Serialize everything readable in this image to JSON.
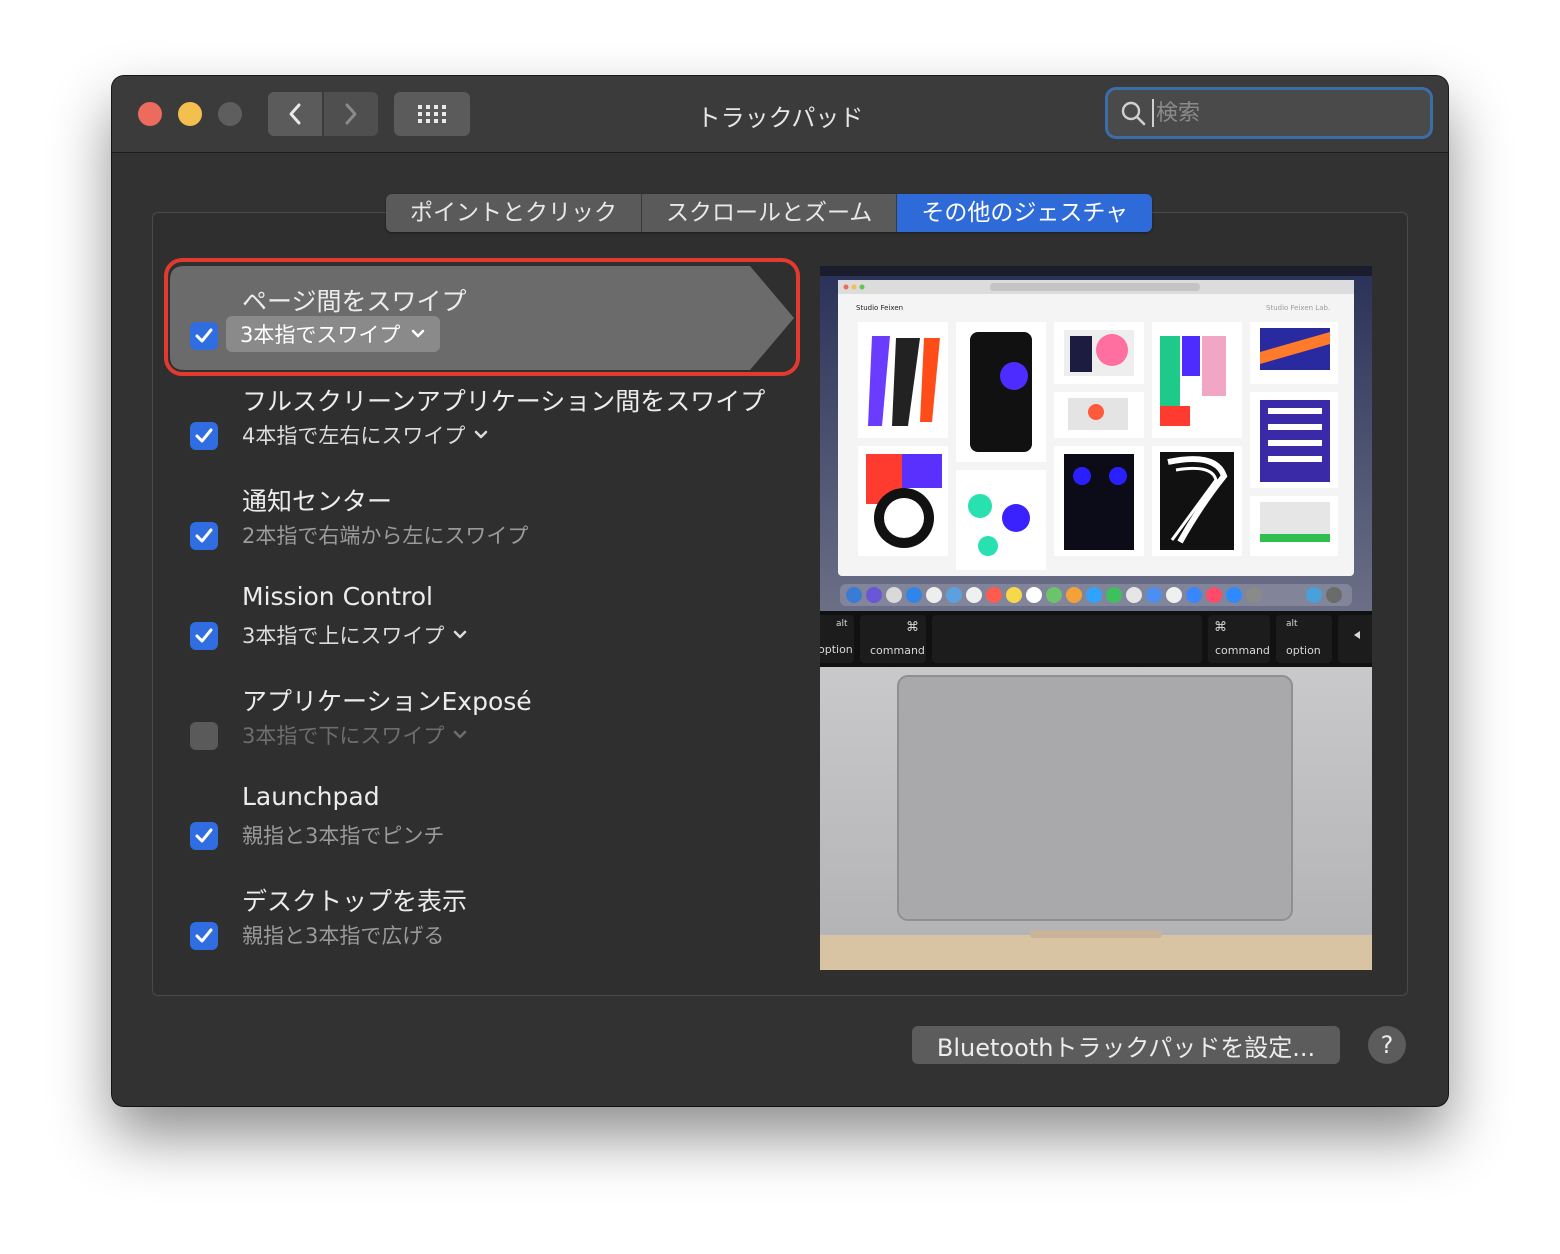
{
  "window": {
    "title": "トラックパッド"
  },
  "search": {
    "placeholder": "検索"
  },
  "tabs": [
    {
      "label": "ポイントとクリック",
      "active": false
    },
    {
      "label": "スクロールとズーム",
      "active": false
    },
    {
      "label": "その他のジェスチャ",
      "active": true
    }
  ],
  "gestures": [
    {
      "title": "ページ間をスワイプ",
      "subtitle": "3本指でスワイプ",
      "checked": true,
      "has_popup": true
    },
    {
      "title": "フルスクリーンアプリケーション間をスワイプ",
      "subtitle": "4本指で左右にスワイプ",
      "checked": true,
      "has_popup": true
    },
    {
      "title": "通知センター",
      "subtitle": "2本指で右端から左にスワイプ",
      "checked": true,
      "has_popup": false
    },
    {
      "title": "Mission Control",
      "subtitle": "3本指で上にスワイプ",
      "checked": true,
      "has_popup": true
    },
    {
      "title": "アプリケーションExposé",
      "subtitle": "3本指で下にスワイプ",
      "checked": false,
      "has_popup": true
    },
    {
      "title": "Launchpad",
      "subtitle": "親指と3本指でピンチ",
      "checked": true,
      "has_popup": false
    },
    {
      "title": "デスクトップを表示",
      "subtitle": "親指と3本指で広げる",
      "checked": true,
      "has_popup": false
    }
  ],
  "preview": {
    "site_title": "Studio Feixen",
    "site_link": "Studio Feixen Lab.",
    "keys": {
      "alt": "alt",
      "option": "option",
      "command_symbol": "⌘",
      "command": "command"
    }
  },
  "buttons": {
    "bluetooth": "Bluetoothトラックパッドを設定...",
    "help": "?"
  },
  "colors": {
    "accent": "#2e6bd8",
    "highlight": "#e23a2e",
    "window_bg": "#323232"
  }
}
